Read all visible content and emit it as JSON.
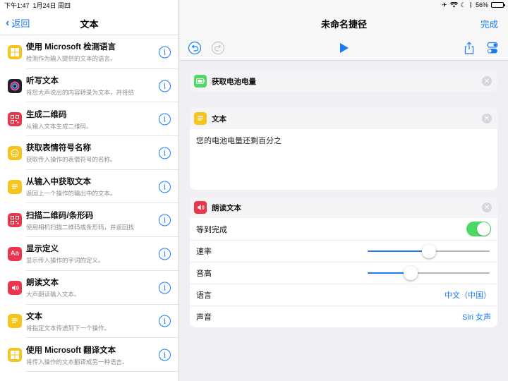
{
  "status_bar": {
    "time": "下午1:47",
    "date": "1月24日 周四",
    "battery_percent": "56%",
    "battery_level": 0.56
  },
  "left": {
    "back_label": "返回",
    "title": "文本",
    "actions": [
      {
        "title": "使用 Microsoft 检测语言",
        "subtitle": "检测作为输入提供的文本的语言。",
        "icon": "microsoft-icon",
        "color": "#f6c51b"
      },
      {
        "title": "听写文本",
        "subtitle": "将您大声说出的内容转录为文本，并将结",
        "icon": "siri-icon",
        "color": "#222222"
      },
      {
        "title": "生成二维码",
        "subtitle": "从输入文本生成二维码。",
        "icon": "qr-code-icon",
        "color": "#e8364d"
      },
      {
        "title": "获取表情符号名称",
        "subtitle": "获取传入操作的表情符号的名称。",
        "icon": "emoji-icon",
        "color": "#f6c51b"
      },
      {
        "title": "从输入中获取文本",
        "subtitle": "返回上一个操作的输出中的文本。",
        "icon": "text-icon",
        "color": "#f6c51b"
      },
      {
        "title": "扫描二维码/条形码",
        "subtitle": "使用相机扫描二维码或条形码，并返回找",
        "icon": "scan-qr-icon",
        "color": "#e8364d"
      },
      {
        "title": "显示定义",
        "subtitle": "显示传入操作的字词的定义。",
        "icon": "dictionary-icon",
        "color": "#e8364d"
      },
      {
        "title": "朗读文本",
        "subtitle": "大声朗读输入文本。",
        "icon": "speaker-icon",
        "color": "#e8364d"
      },
      {
        "title": "文本",
        "subtitle": "将指定文本传递到下一个操作。",
        "icon": "text-icon",
        "color": "#f6c51b"
      },
      {
        "title": "使用 Microsoft 翻译文本",
        "subtitle": "将传入操作的文本翻译成另一种语言。",
        "icon": "microsoft-icon",
        "color": "#f6c51b"
      }
    ]
  },
  "right": {
    "title": "未命名捷径",
    "done_label": "完成",
    "battery_action": {
      "title": "获取电池电量",
      "icon": "battery-icon",
      "color": "#4cd964"
    },
    "text_action": {
      "title": "文本",
      "content": "您的电池电量还剩百分之",
      "icon": "text-icon",
      "color": "#f6c51b"
    },
    "speak_action": {
      "title": "朗读文本",
      "icon": "speaker-icon",
      "color": "#e8364d",
      "wait_label": "等到完成",
      "wait_enabled": true,
      "rate_label": "速率",
      "rate_value": 0.5,
      "pitch_label": "音高",
      "pitch_value": 0.35,
      "language_label": "语言",
      "language_value": "中文（中国）",
      "voice_label": "声音",
      "voice_value": "Siri 女声"
    }
  },
  "colors": {
    "accent": "#1a7cf5",
    "toggle_on": "#4cd964"
  }
}
